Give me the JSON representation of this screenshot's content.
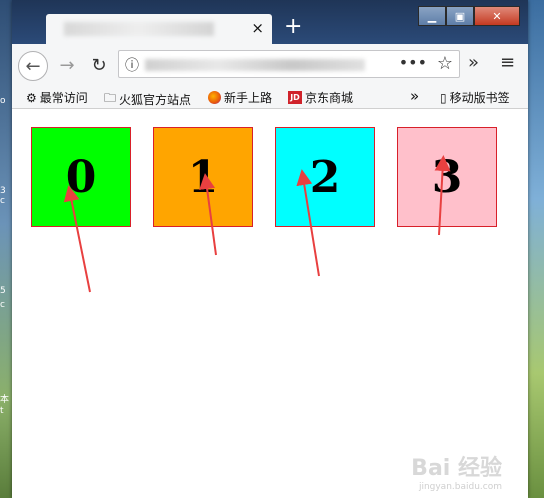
{
  "tab": {
    "close_glyph": "×",
    "newtab_glyph": "+"
  },
  "window_controls": {
    "min": "▁",
    "max": "▣",
    "close": "✕"
  },
  "nav": {
    "back": "←",
    "forward": "→",
    "reload": "↻",
    "info": "ⓘ",
    "dots": "•••",
    "star": "☆",
    "overflow": "»",
    "menu": "≡"
  },
  "bookmarks": {
    "items": [
      {
        "label": "最常访问",
        "icon": "gear-icon"
      },
      {
        "label": "火狐官方站点",
        "icon": "folder-icon"
      },
      {
        "label": "新手上路",
        "icon": "firefox-icon"
      },
      {
        "label": "京东商城",
        "icon": "jd-icon"
      }
    ],
    "overflow": "»",
    "mobile": "移动版书签"
  },
  "boxes": [
    {
      "label": "0",
      "color": "#00ff00"
    },
    {
      "label": "1",
      "color": "#ffa500"
    },
    {
      "label": "2",
      "color": "#00ffff"
    },
    {
      "label": "3",
      "color": "#ffc0cb"
    }
  ],
  "annotation_color": "#e84040",
  "watermark": {
    "text": "Bai 经验",
    "sub": "jingyan.baidu.com"
  }
}
